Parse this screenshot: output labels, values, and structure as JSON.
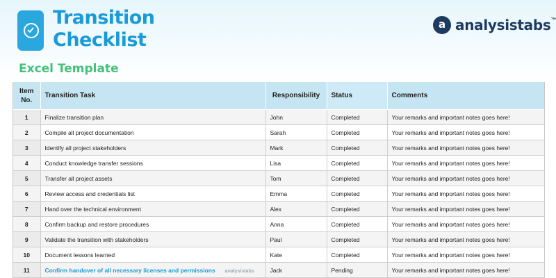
{
  "header": {
    "title_line1": "Transition",
    "title_line2": "Checklist",
    "subtitle": "Excel Template",
    "brand": "analysistabs",
    "brand_tm": "™",
    "brand_mark": "a"
  },
  "table": {
    "columns": {
      "no_line1": "Item",
      "no_line2": "No.",
      "task": "Transition Task",
      "responsibility": "Responsibility",
      "status": "Status",
      "comments": "Comments"
    },
    "watermark": "analysistabs",
    "rows": [
      {
        "no": "1",
        "task": "Finalize transition plan",
        "responsibility": "John",
        "status": "Completed",
        "comments": "Your remarks and important notes goes here!"
      },
      {
        "no": "2",
        "task": "Compile all project documentation",
        "responsibility": "Sarah",
        "status": "Completed",
        "comments": "Your remarks and important notes goes here!"
      },
      {
        "no": "3",
        "task": "Identify all project stakeholders",
        "responsibility": "Mark",
        "status": "Completed",
        "comments": "Your remarks and important notes goes here!"
      },
      {
        "no": "4",
        "task": "Conduct knowledge transfer sessions",
        "responsibility": "Lisa",
        "status": "Completed",
        "comments": "Your remarks and important notes goes here!"
      },
      {
        "no": "5",
        "task": "Transfer all project assets",
        "responsibility": "Tom",
        "status": "Completed",
        "comments": "Your remarks and important notes goes here!"
      },
      {
        "no": "6",
        "task": "Review access and credentials list",
        "responsibility": "Emma",
        "status": "Completed",
        "comments": "Your remarks and important notes goes here!"
      },
      {
        "no": "7",
        "task": "Hand over the technical environment",
        "responsibility": "Alex",
        "status": "Completed",
        "comments": "Your remarks and important notes goes here!"
      },
      {
        "no": "8",
        "task": "Confirm backup and restore procedures",
        "responsibility": "Anna",
        "status": "Completed",
        "comments": "Your remarks and important notes goes here!"
      },
      {
        "no": "9",
        "task": "Validate the transition with stakeholders",
        "responsibility": "Paul",
        "status": "Completed",
        "comments": "Your remarks and important notes goes here!"
      },
      {
        "no": "10",
        "task": "Document lessons learned",
        "responsibility": "Kate",
        "status": "Completed",
        "comments": "Your remarks and important notes goes here!"
      },
      {
        "no": "11",
        "task": "Confirm handover of all necessary licenses and permissions",
        "responsibility": "Jack",
        "status": "Pending",
        "comments": "Your remarks and important notes goes here!"
      }
    ]
  },
  "colors": {
    "title": "#1a9bd8",
    "subtitle": "#45c07a",
    "header_fill": "#c6e5f3",
    "brand": "#1e3a5f"
  }
}
